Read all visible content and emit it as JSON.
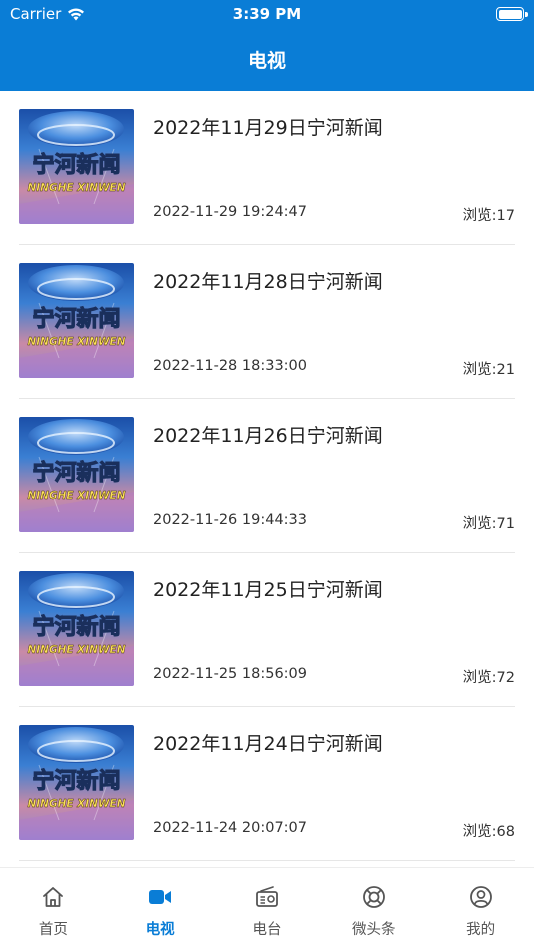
{
  "status_bar": {
    "carrier": "Carrier",
    "time": "3:39 PM"
  },
  "nav": {
    "title": "电视"
  },
  "items": [
    {
      "title": "2022年11月29日宁河新闻",
      "date": "2022-11-29 19:24:47",
      "views": "浏览:17",
      "thumb_line1": "宁河新闻",
      "thumb_line2": "NINGHE XINWEN"
    },
    {
      "title": "2022年11月28日宁河新闻",
      "date": "2022-11-28 18:33:00",
      "views": "浏览:21",
      "thumb_line1": "宁河新闻",
      "thumb_line2": "NINGHE XINWEN"
    },
    {
      "title": "2022年11月26日宁河新闻",
      "date": "2022-11-26 19:44:33",
      "views": "浏览:71",
      "thumb_line1": "宁河新闻",
      "thumb_line2": "NINGHE XINWEN"
    },
    {
      "title": "2022年11月25日宁河新闻",
      "date": "2022-11-25 18:56:09",
      "views": "浏览:72",
      "thumb_line1": "宁河新闻",
      "thumb_line2": "NINGHE XINWEN"
    },
    {
      "title": "2022年11月24日宁河新闻",
      "date": "2022-11-24 20:07:07",
      "views": "浏览:68",
      "thumb_line1": "宁河新闻",
      "thumb_line2": "NINGHE XINWEN"
    }
  ],
  "tabbar": {
    "tabs": [
      {
        "label": "首页",
        "icon": "home-icon"
      },
      {
        "label": "电视",
        "icon": "video-camera-icon"
      },
      {
        "label": "电台",
        "icon": "radio-icon"
      },
      {
        "label": "微头条",
        "icon": "lifebuoy-icon"
      },
      {
        "label": "我的",
        "icon": "user-icon"
      }
    ],
    "active_index": 1
  },
  "colors": {
    "brand": "#0a7dd6",
    "text": "#222222",
    "muted": "#555555"
  }
}
